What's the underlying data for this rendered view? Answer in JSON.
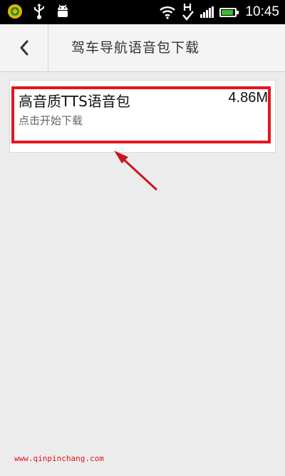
{
  "status_bar": {
    "time": "10:45",
    "icons": [
      "app-icon",
      "usb-icon",
      "android-icon",
      "wifi-icon",
      "h-signal-icon",
      "signal-icon",
      "battery-icon"
    ],
    "battery_color": "#3bbf2f"
  },
  "header": {
    "title": "驾车导航语音包下载",
    "back_icon": "chevron-left-icon"
  },
  "item": {
    "title": "高音质TTS语音包",
    "size": "4.86M",
    "subtitle": "点击开始下载"
  },
  "annotation": {
    "highlight_color": "#e8141c"
  },
  "watermark": "www.qinpinchang.com"
}
